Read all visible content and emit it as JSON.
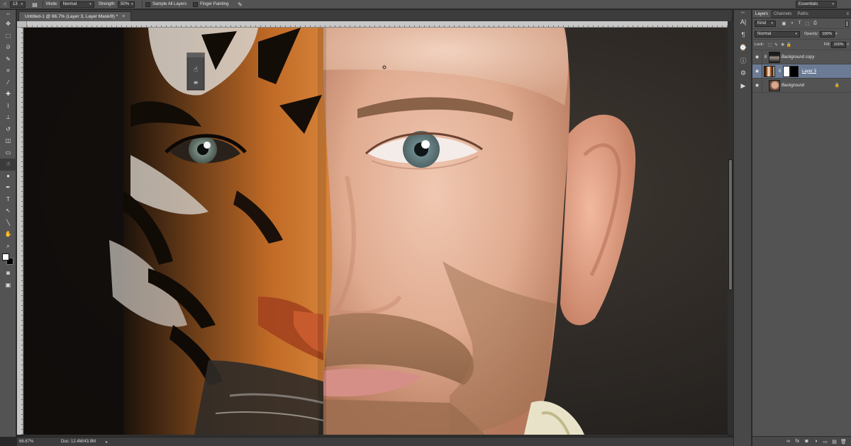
{
  "options_bar": {
    "brush_size": "13",
    "mode_label": "Mode:",
    "mode_value": "Normal",
    "strength_label": "Strength:",
    "strength_value": "50%",
    "sample_all_layers": "Sample All Layers",
    "finger_painting": "Finger Painting",
    "workspace": "Essentials",
    "tool_icon": "smudge-icon"
  },
  "document": {
    "tab_title": "Untitled-1 @ 66.7% (Layer 3, Layer Mask/8) *",
    "tab_close": "×"
  },
  "status_bar": {
    "zoom": "66.67%",
    "doc_size": "Doc: 12.4M/43.9M",
    "arrow": "▸"
  },
  "toolbar": {
    "collapse": "◂◂",
    "tools": [
      {
        "name": "move-tool",
        "glyph": "✥"
      },
      {
        "name": "marquee-tool",
        "glyph": "⬚"
      },
      {
        "name": "lasso-tool",
        "glyph": "ᘐ"
      },
      {
        "name": "quick-select-tool",
        "glyph": "✎"
      },
      {
        "name": "crop-tool",
        "glyph": "⌗"
      },
      {
        "name": "eyedropper-tool",
        "glyph": "⁄"
      },
      {
        "name": "healing-brush-tool",
        "glyph": "✚"
      },
      {
        "name": "brush-tool",
        "glyph": "⌇"
      },
      {
        "name": "clone-stamp-tool",
        "glyph": "⊥"
      },
      {
        "name": "history-brush-tool",
        "glyph": "↺"
      },
      {
        "name": "eraser-tool",
        "glyph": "◫"
      },
      {
        "name": "gradient-tool",
        "glyph": "▭"
      },
      {
        "name": "smudge-tool",
        "glyph": "☝"
      },
      {
        "name": "dodge-tool",
        "glyph": "●"
      },
      {
        "name": "pen-tool",
        "glyph": "✒"
      },
      {
        "name": "type-tool",
        "glyph": "T"
      },
      {
        "name": "path-select-tool",
        "glyph": "↖"
      },
      {
        "name": "shape-tool",
        "glyph": "╲"
      },
      {
        "name": "hand-tool",
        "glyph": "✋"
      },
      {
        "name": "zoom-tool",
        "glyph": "⌕"
      }
    ],
    "after_swatches": [
      {
        "name": "quick-mask-tool",
        "glyph": "◙"
      },
      {
        "name": "screen-mode-tool",
        "glyph": "▣"
      }
    ]
  },
  "panel_icons": {
    "grip": "◂◂",
    "items": [
      {
        "name": "character-panel-icon",
        "glyph": "A|"
      },
      {
        "name": "paragraph-panel-icon",
        "glyph": "¶"
      },
      {
        "name": "history-panel-icon",
        "glyph": "⌚"
      },
      {
        "name": "info-panel-icon",
        "glyph": "ⓘ"
      },
      {
        "name": "tool-presets-panel-icon",
        "glyph": "⚙"
      },
      {
        "name": "actions-panel-icon",
        "glyph": "▶"
      }
    ]
  },
  "layers_panel": {
    "tabs": [
      "Layers",
      "Channels",
      "Paths"
    ],
    "menu_glyph": "≡",
    "filter_kind": "Kind",
    "filter_glyphs": [
      "▣",
      "◑",
      "T",
      "⬚",
      "⎙"
    ],
    "blend_mode": "Normal",
    "opacity_label": "Opacity:",
    "opacity_value": "100%",
    "lock_label": "Lock:",
    "lock_glyphs": [
      "⬚",
      "✎",
      "✥",
      "🔒"
    ],
    "fill_label": "Fill:",
    "fill_value": "100%",
    "layers": [
      {
        "name": "Background copy",
        "chain": "8"
      },
      {
        "name": "Layer 3",
        "chain": "8"
      },
      {
        "name": "Background",
        "chain": ""
      }
    ],
    "eye_glyph": "◉",
    "lock_glyph": "🔒",
    "footer_glyphs": [
      "∞",
      "fx",
      "◙",
      "◑",
      "▭",
      "▤",
      "🗑"
    ]
  },
  "colors": {
    "ui_panel": "#535353",
    "ui_dark": "#282828",
    "selected_layer": "#6b7b95",
    "skin": "#e0ab90",
    "tiger_orange": "#c8702a",
    "studio_bg": "#3a342f"
  }
}
